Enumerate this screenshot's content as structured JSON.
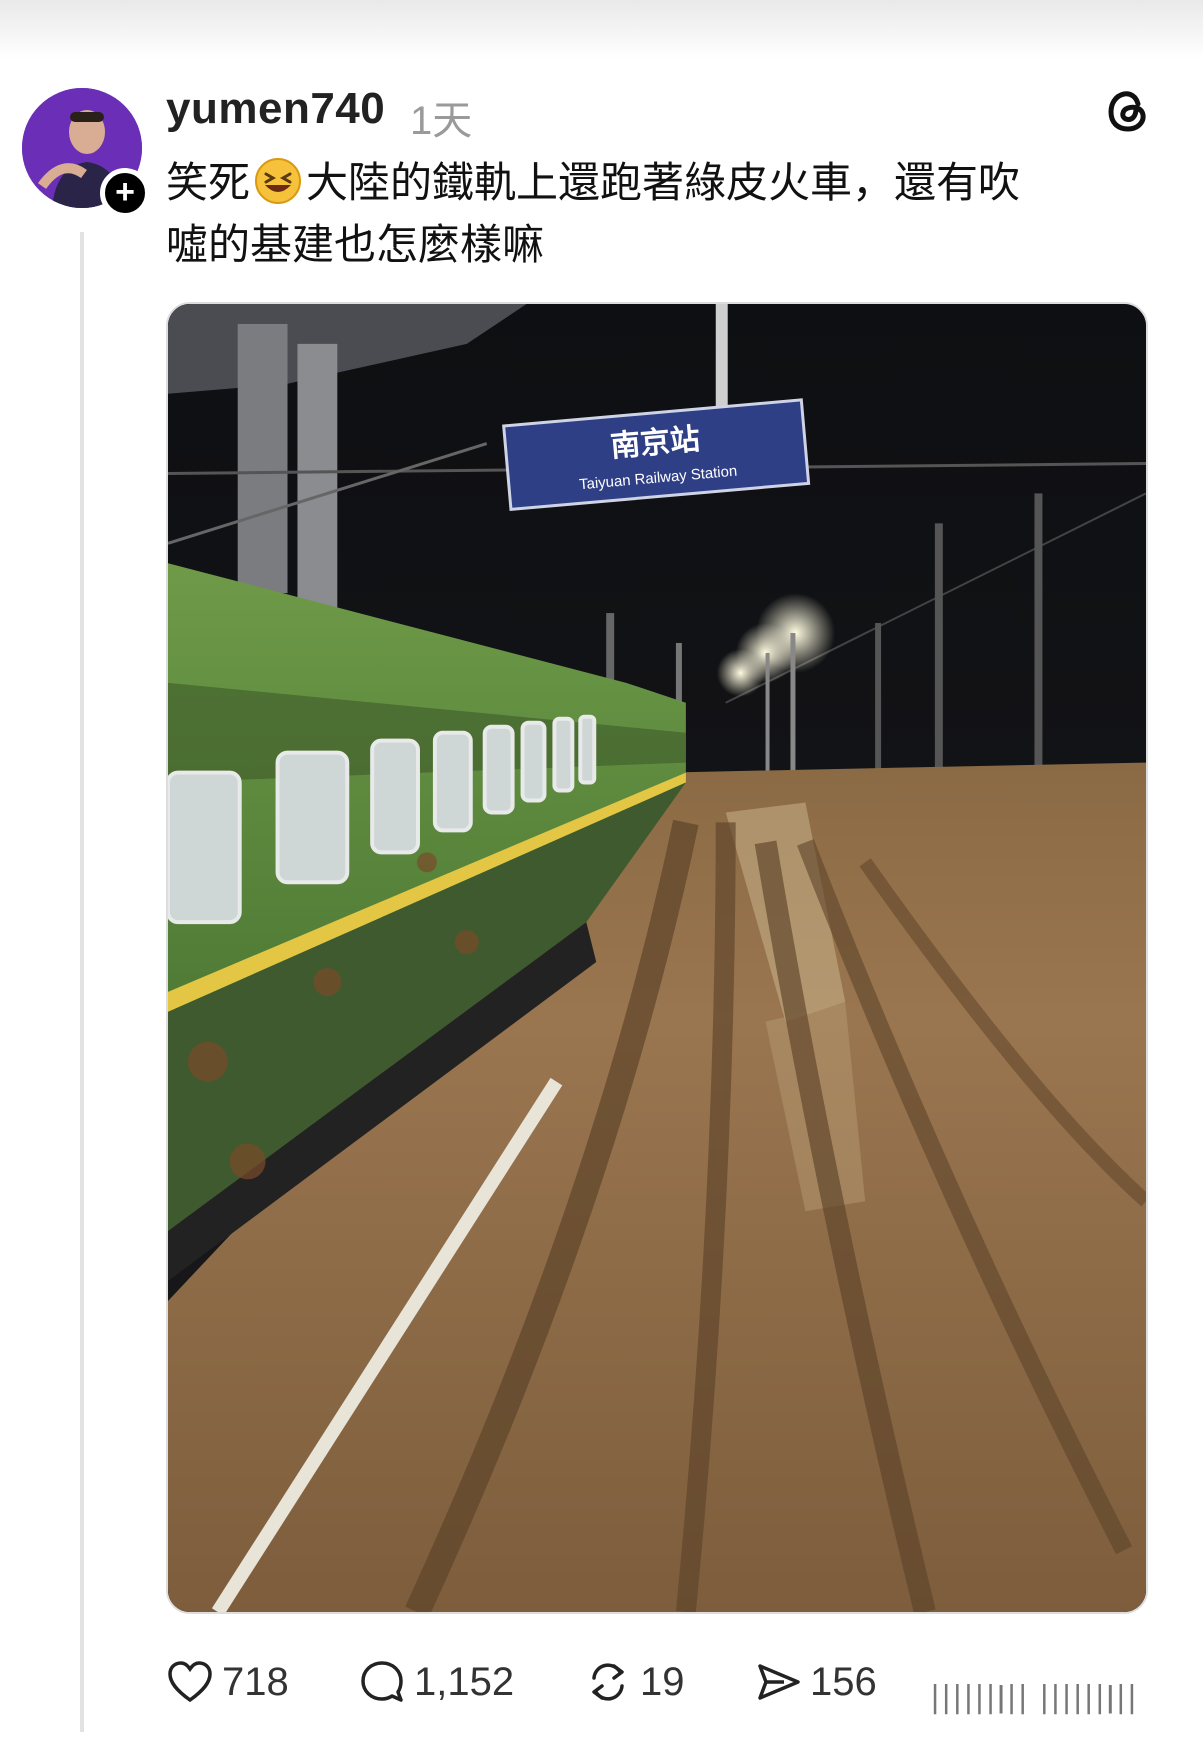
{
  "post": {
    "username": "yumen740",
    "time": "1天",
    "text_line1_part1": "笑死",
    "text_line1_part2": "大陸的鐵軌上還跑著綠皮火車，還有吹",
    "text_line2": "噓的基建也怎麼樣嘛",
    "emoji": "laughing-face-emoji"
  },
  "photo": {
    "sign_main": "南京站",
    "sign_sub": "Taiyuan Railway Station",
    "icon": "photo-train-mud"
  },
  "actions": {
    "likes": "718",
    "comments": "1,152",
    "reposts": "19",
    "shares": "156"
  },
  "icons": {
    "like": "heart-icon",
    "comment": "comment-bubble-icon",
    "repost": "repost-icon",
    "share": "send-icon",
    "logo": "threads-logo-icon",
    "follow": "plus-icon"
  },
  "colors": {
    "username": "#222222",
    "time": "#9a9a9a",
    "sign_blue": "#2f3f86",
    "train_green": "#5a8a3a"
  }
}
